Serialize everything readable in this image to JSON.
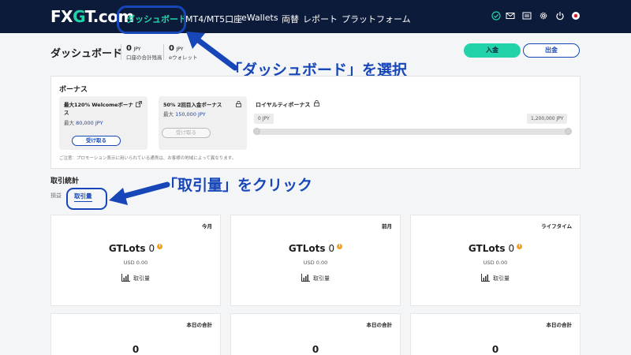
{
  "header": {
    "logo_fx": "FX",
    "logo_g": "G",
    "logo_t": "T.com",
    "nav": [
      "ダッシュボード",
      "MT4/MT5口座",
      "eWallets",
      "両替",
      "レポート",
      "プラットフォーム"
    ],
    "active_nav": 0,
    "icons": [
      "check-circle-icon",
      "mail-icon",
      "id-card-icon",
      "gear-icon",
      "power-icon",
      "japan-flag-icon"
    ]
  },
  "summary": {
    "title": "ダッシュボード",
    "balance_value": "0",
    "balance_unit": "JPY",
    "balance_label": "口座の合計残高",
    "ewallet_value": "0",
    "ewallet_unit": "JPY",
    "ewallet_label": "eウォレット",
    "deposit_label": "入金",
    "withdraw_label": "出金"
  },
  "annotations": {
    "dashboard": "「ダッシュボード」を選択",
    "volume": "「取引量」をクリック"
  },
  "bonus": {
    "title": "ボーナス",
    "cards": [
      {
        "title": "最大120% Welcomeボーナス",
        "amount_prefix": "最大",
        "amount": "80,000 JPY",
        "button": "受け取る",
        "enabled": true
      },
      {
        "title": "50% 2回目入金ボーナス",
        "amount_prefix": "最大",
        "amount": "150,000 JPY",
        "button": "受け取る",
        "enabled": false
      }
    ],
    "royalty_title": "ロイヤルティボーナス",
    "royalty_min": "0 JPY",
    "royalty_max": "1,200,000 JPY",
    "royalty_progress": 0,
    "note": "ご注意：プロモーション表示に用いられている通貨は、お客様の地域によって異なります。"
  },
  "stats": {
    "title": "取引統計",
    "sub": "損益",
    "tab_volume": "取引量",
    "cards": [
      {
        "period": "今月",
        "metric": "GTLots",
        "value": "0",
        "usd": "USD  0.00",
        "volume_label": "取引量"
      },
      {
        "period": "前月",
        "metric": "GTLots",
        "value": "0",
        "usd": "USD  0.00",
        "volume_label": "取引量"
      },
      {
        "period": "ライフタイム",
        "metric": "GTLots",
        "value": "0",
        "usd": "USD  0.00",
        "volume_label": "取引量"
      }
    ],
    "today_cards": [
      {
        "period": "本日の合計",
        "value": "0"
      },
      {
        "period": "本日の合計",
        "value": "0"
      },
      {
        "period": "本日の合計",
        "value": "0"
      }
    ]
  }
}
